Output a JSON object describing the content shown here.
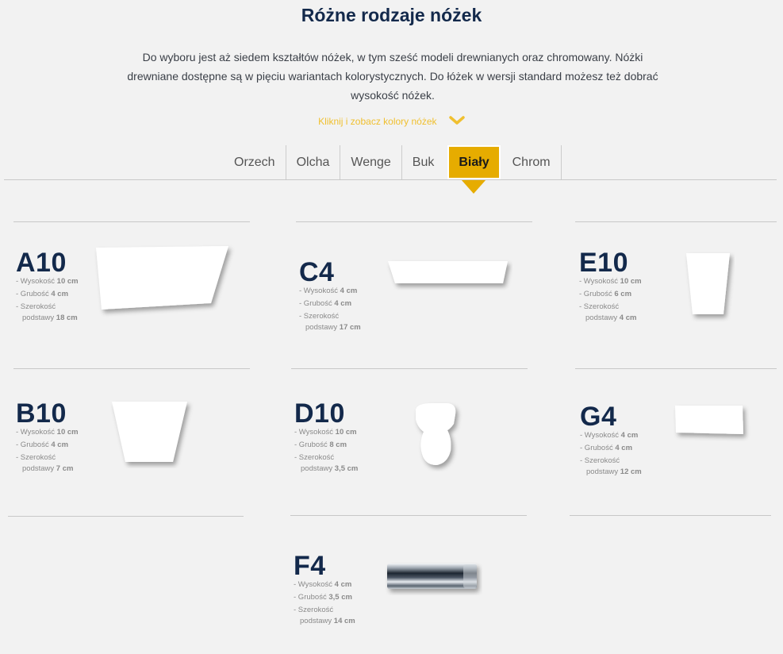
{
  "header": {
    "title": "Różne rodzaje nóżek",
    "description": "Do wyboru jest aż siedem kształtów nóżek, w tym sześć modeli drewnianych oraz chromowany. Nóżki drewniane dostępne są w pięciu wariantach kolorystycznych. Do łóżek w wersji standard możesz też dobrać wysokość nóżek.",
    "colors_link": "Kliknij i zobacz kolory nóżek"
  },
  "tabs": [
    {
      "label": "Orzech"
    },
    {
      "label": "Olcha"
    },
    {
      "label": "Wenge"
    },
    {
      "label": "Buk"
    },
    {
      "label": "Biały"
    },
    {
      "label": "Chrom"
    }
  ],
  "active_tab": "Biały",
  "colors": {
    "accent": "#e6ac00",
    "title": "#13294b",
    "link": "#f0c030"
  },
  "labels": {
    "height": "- Wysokość",
    "thickness": "- Grubość",
    "base1": "- Szerokość",
    "base2": "podstawy"
  },
  "items": [
    {
      "code": "A10",
      "height": "10 cm",
      "thickness": "4 cm",
      "base": "18 cm"
    },
    {
      "code": "C4",
      "height": "4 cm",
      "thickness": "4 cm",
      "base": "17 cm"
    },
    {
      "code": "E10",
      "height": "10 cm",
      "thickness": "6 cm",
      "base": "4 cm"
    },
    {
      "code": "B10",
      "height": "10 cm",
      "thickness": "4 cm",
      "base": "7 cm"
    },
    {
      "code": "D10",
      "height": "10 cm",
      "thickness": "8 cm",
      "base": "3,5 cm"
    },
    {
      "code": "G4",
      "height": "4 cm",
      "thickness": "4 cm",
      "base": "12 cm"
    },
    {
      "code": "F4",
      "height": "4 cm",
      "thickness": "3,5 cm",
      "base": "14 cm"
    }
  ]
}
